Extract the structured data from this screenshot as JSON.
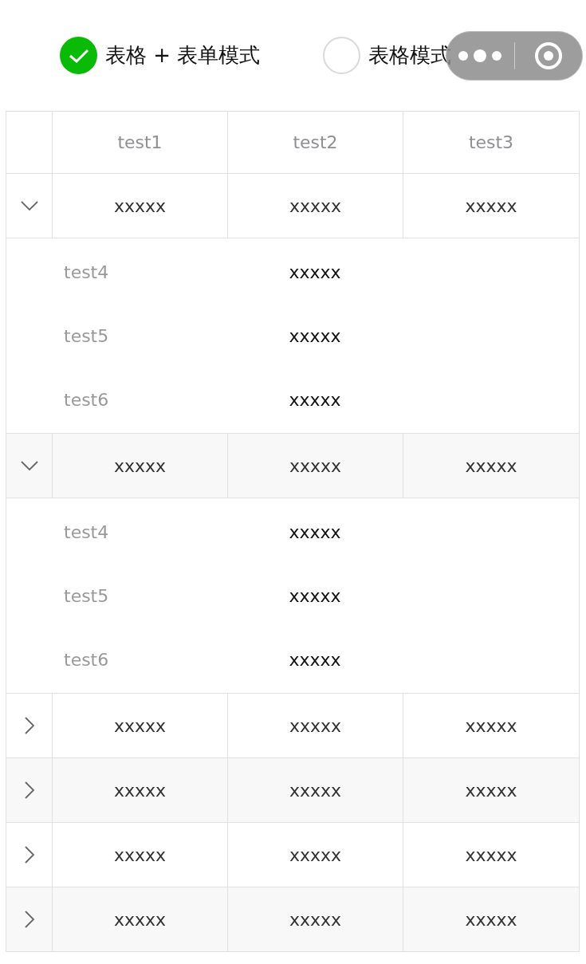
{
  "mode_options": [
    {
      "label": "表格 + 表单模式",
      "selected": true
    },
    {
      "label": "表格模式",
      "selected": false
    }
  ],
  "table": {
    "columns": [
      "test1",
      "test2",
      "test3"
    ],
    "rows": [
      {
        "expanded": true,
        "cells": [
          "xxxxx",
          "xxxxx",
          "xxxxx"
        ],
        "details": [
          {
            "label": "test4",
            "value": "xxxxx"
          },
          {
            "label": "test5",
            "value": "xxxxx"
          },
          {
            "label": "test6",
            "value": "xxxxx"
          }
        ]
      },
      {
        "expanded": true,
        "cells": [
          "xxxxx",
          "xxxxx",
          "xxxxx"
        ],
        "details": [
          {
            "label": "test4",
            "value": "xxxxx"
          },
          {
            "label": "test5",
            "value": "xxxxx"
          },
          {
            "label": "test6",
            "value": "xxxxx"
          }
        ]
      },
      {
        "expanded": false,
        "cells": [
          "xxxxx",
          "xxxxx",
          "xxxxx"
        ]
      },
      {
        "expanded": false,
        "cells": [
          "xxxxx",
          "xxxxx",
          "xxxxx"
        ]
      },
      {
        "expanded": false,
        "cells": [
          "xxxxx",
          "xxxxx",
          "xxxxx"
        ]
      },
      {
        "expanded": false,
        "cells": [
          "xxxxx",
          "xxxxx",
          "xxxxx"
        ]
      }
    ]
  }
}
